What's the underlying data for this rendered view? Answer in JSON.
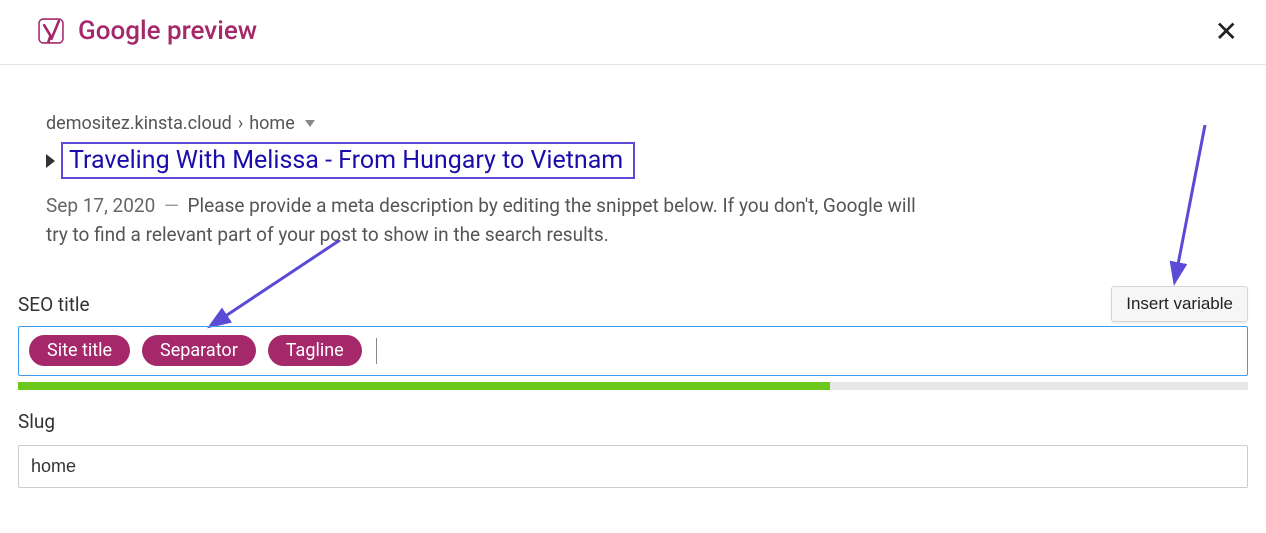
{
  "header": {
    "title": "Google preview"
  },
  "preview": {
    "breadcrumb_host": "demositez.kinsta.cloud",
    "breadcrumb_sep": "›",
    "breadcrumb_path": "home",
    "title": "Traveling With Melissa - From Hungary to Vietnam",
    "date": "Sep 17, 2020",
    "description": "Please provide a meta description by editing the snippet below. If you don't, Google will try to find a relevant part of your post to show in the search results."
  },
  "seo_title": {
    "label": "SEO title",
    "insert_button": "Insert variable",
    "pills": [
      "Site title",
      "Separator",
      "Tagline"
    ],
    "progress_percent": 66
  },
  "slug": {
    "label": "Slug",
    "value": "home"
  }
}
